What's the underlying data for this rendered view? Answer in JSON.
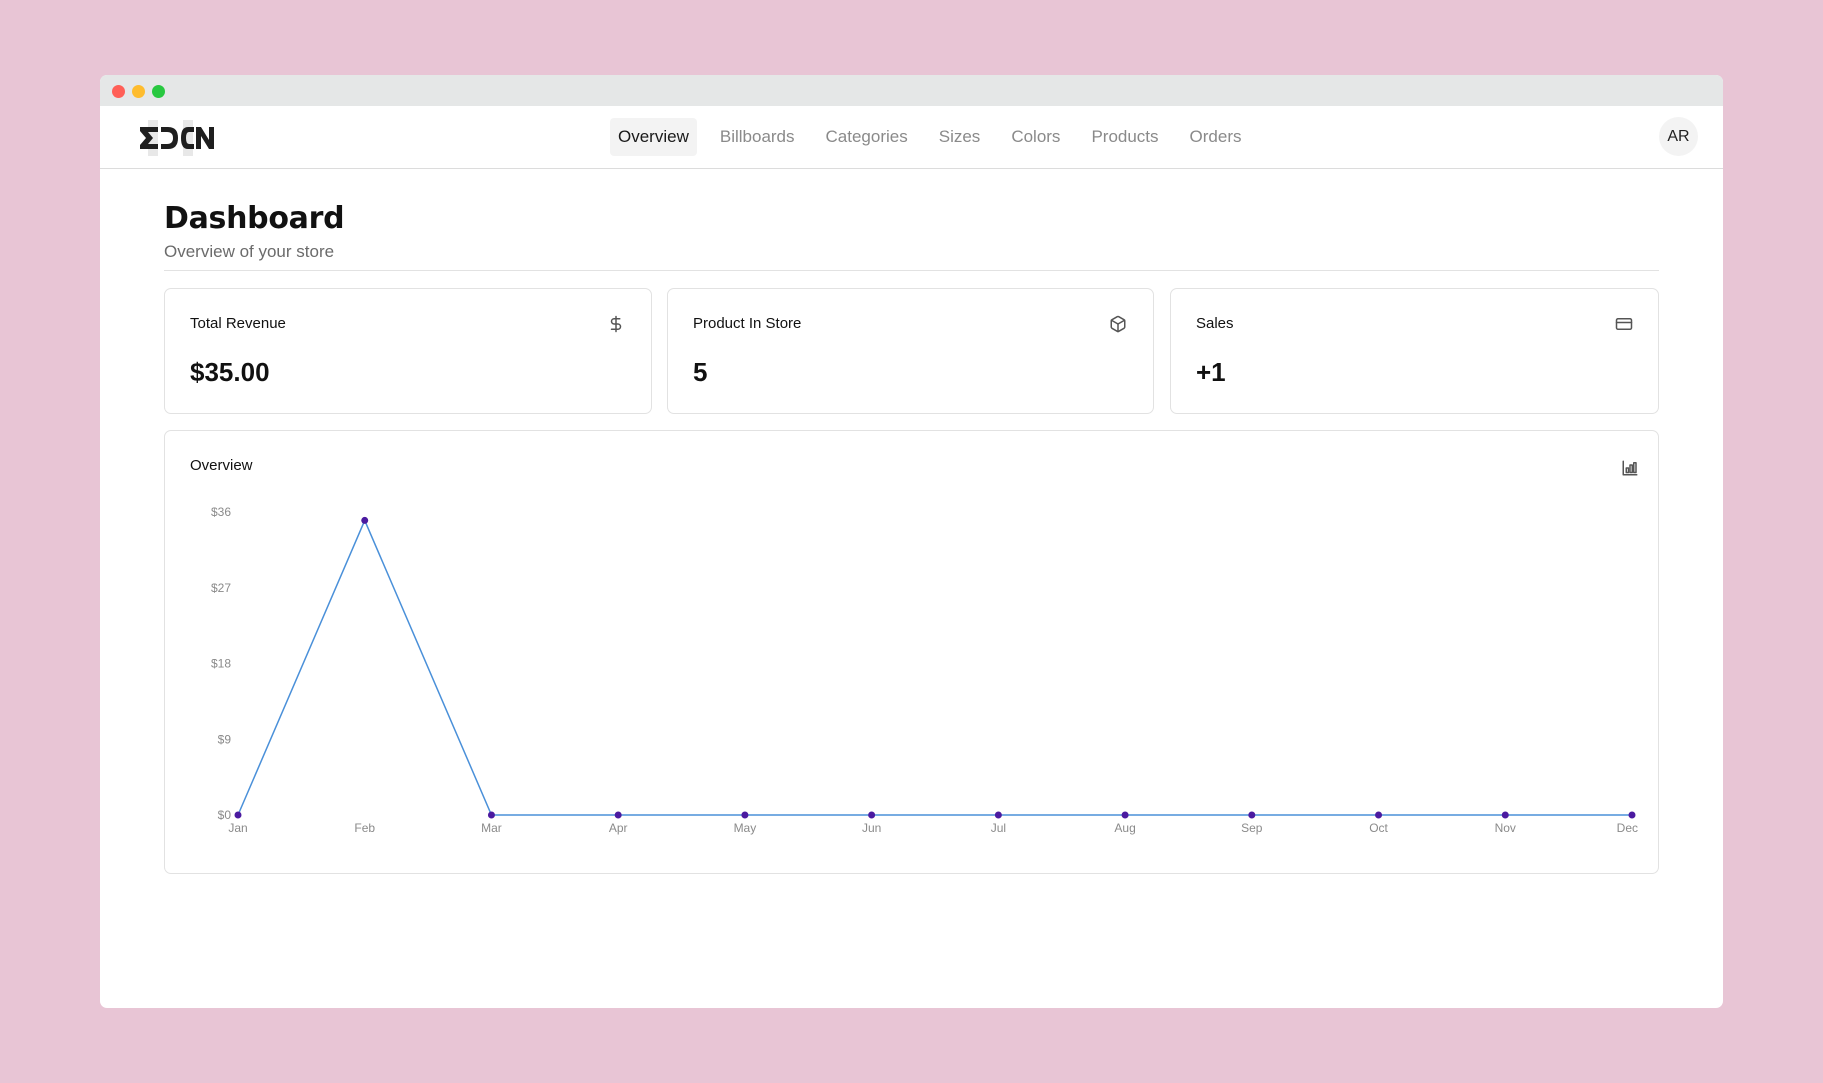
{
  "window": {
    "traffic_lights": [
      "#ff5f57",
      "#febc2e",
      "#28c840"
    ]
  },
  "navbar": {
    "logo_name": "edcn-logo",
    "tabs": [
      {
        "label": "Overview",
        "active": true
      },
      {
        "label": "Billboards",
        "active": false
      },
      {
        "label": "Categories",
        "active": false
      },
      {
        "label": "Sizes",
        "active": false
      },
      {
        "label": "Colors",
        "active": false
      },
      {
        "label": "Products",
        "active": false
      },
      {
        "label": "Orders",
        "active": false
      }
    ],
    "avatar_initials": "AR"
  },
  "page": {
    "title": "Dashboard",
    "subtitle": "Overview of your store"
  },
  "stats": [
    {
      "title": "Total Revenue",
      "value": "$35.00",
      "icon": "dollar-icon"
    },
    {
      "title": "Product In Store",
      "value": "5",
      "icon": "package-icon"
    },
    {
      "title": "Sales",
      "value": "+1",
      "icon": "credit-card-icon"
    }
  ],
  "overview": {
    "title": "Overview",
    "icon": "bar-chart-icon"
  },
  "chart_data": {
    "type": "line",
    "categories": [
      "Jan",
      "Feb",
      "Mar",
      "Apr",
      "May",
      "Jun",
      "Jul",
      "Aug",
      "Sep",
      "Oct",
      "Nov",
      "Dec"
    ],
    "values": [
      0,
      35,
      0,
      0,
      0,
      0,
      0,
      0,
      0,
      0,
      0,
      0
    ],
    "yticks": [
      "$0",
      "$9",
      "$18",
      "$27",
      "$36"
    ],
    "ylim": [
      0,
      36
    ],
    "line_color": "#4a90d9",
    "point_color": "#4b1aa0",
    "grid": false
  },
  "colors": {
    "background": "#e8c5d5",
    "window": "#ffffff",
    "active_tab_bg": "#f3f3f3"
  }
}
